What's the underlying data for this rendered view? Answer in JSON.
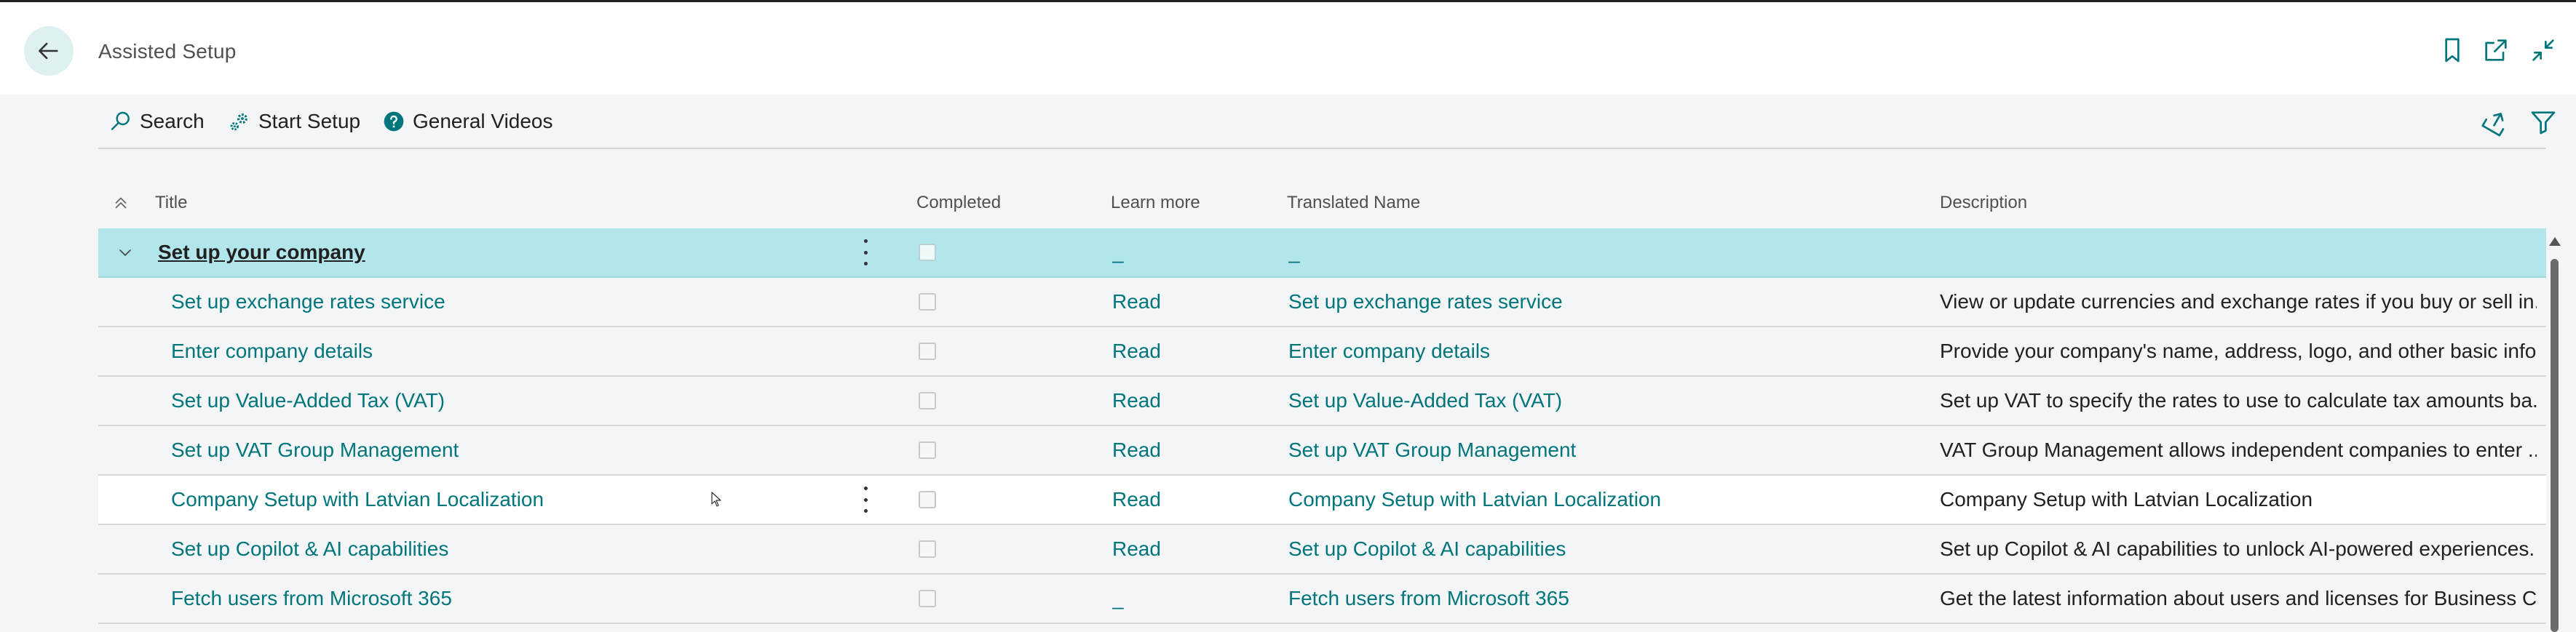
{
  "page": {
    "title": "Assisted Setup"
  },
  "actions": {
    "search": "Search",
    "start_setup": "Start Setup",
    "general_videos": "General Videos"
  },
  "columns": {
    "title": "Title",
    "completed": "Completed",
    "learn_more": "Learn more",
    "translated_name": "Translated Name",
    "description": "Description"
  },
  "group": {
    "title": "Set up your company",
    "learn_more": "_",
    "translated_name": "_"
  },
  "rows": [
    {
      "title": "Set up exchange rates service",
      "learn_more": "Read",
      "translated_name": "Set up exchange rates service",
      "description": "View or update currencies and exchange rates if you buy or sell in..."
    },
    {
      "title": "Enter company details",
      "learn_more": "Read",
      "translated_name": "Enter company details",
      "description": "Provide your company's name, address, logo, and other basic info..."
    },
    {
      "title": "Set up Value-Added Tax (VAT)",
      "learn_more": "Read",
      "translated_name": "Set up Value-Added Tax (VAT)",
      "description": "Set up VAT to specify the rates to use to calculate tax amounts ba..."
    },
    {
      "title": "Set up VAT Group Management",
      "learn_more": "Read",
      "translated_name": "Set up VAT Group Management",
      "description": "VAT Group Management allows independent companies to enter ..."
    },
    {
      "title": "Company Setup with Latvian Localization",
      "learn_more": "Read",
      "translated_name": "Company Setup with Latvian Localization",
      "description": "Company Setup with Latvian Localization"
    },
    {
      "title": "Set up Copilot & AI capabilities",
      "learn_more": "Read",
      "translated_name": "Set up Copilot & AI capabilities",
      "description": "Set up Copilot & AI capabilities to unlock AI-powered experiences."
    },
    {
      "title": "Fetch users from Microsoft 365",
      "learn_more": "_",
      "translated_name": "Fetch users from Microsoft 365",
      "description": "Get the latest information about users and licenses for Business C..."
    }
  ],
  "colors": {
    "accent": "#00767c",
    "group_row": "#b3e6ea",
    "back_button": "#dff0f1"
  }
}
